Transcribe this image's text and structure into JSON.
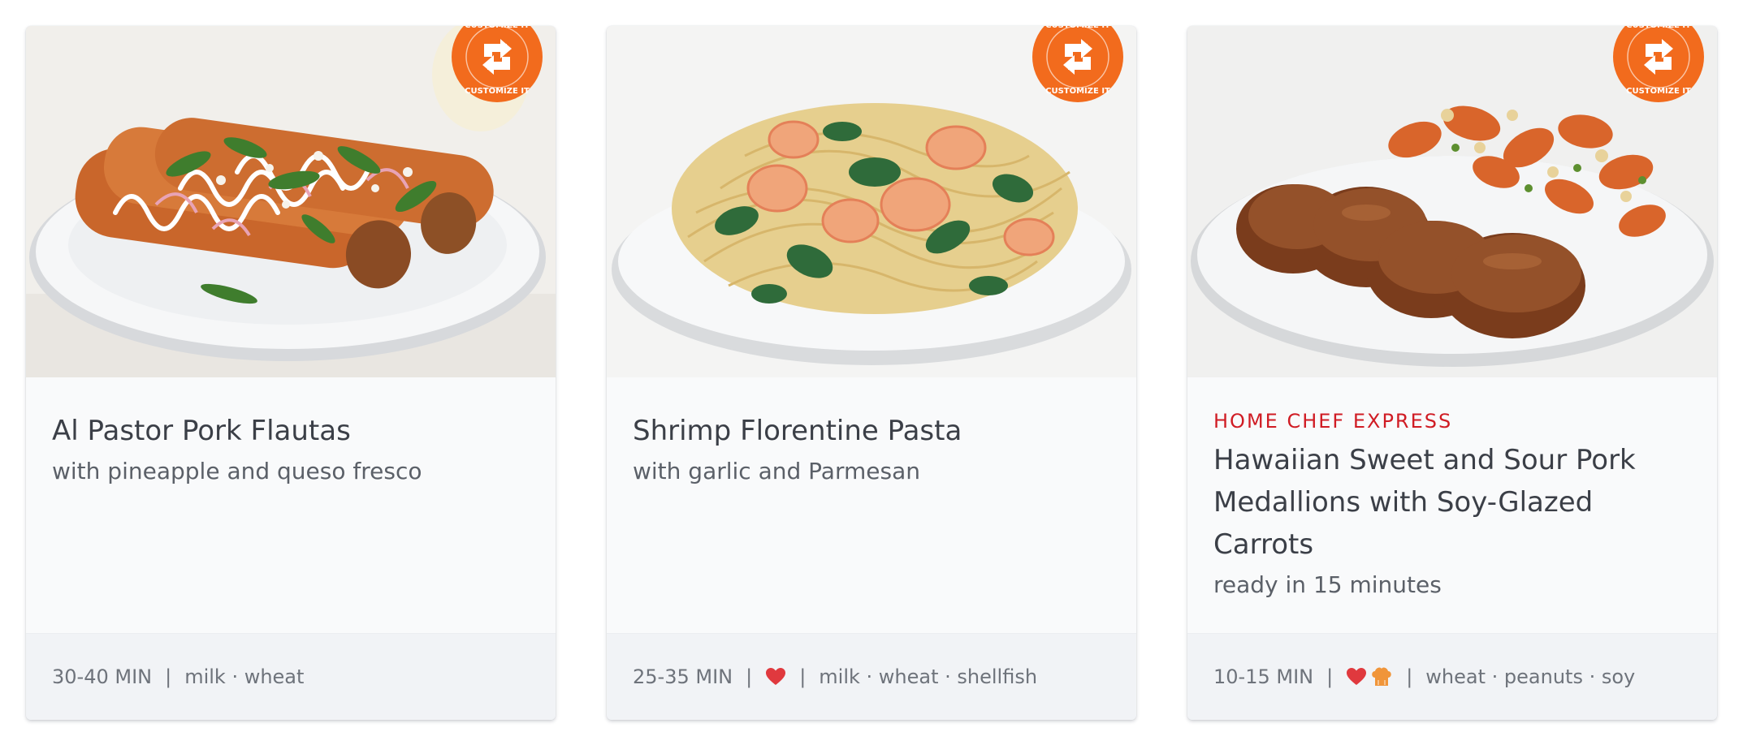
{
  "cards": [
    {
      "badge_text": "CUSTOMIZE IT",
      "eyebrow": "",
      "title": "Al Pastor Pork Flautas",
      "subtitle": "with pineapple and queso fresco",
      "time": "30-40 MIN",
      "separator": "|",
      "icons": [],
      "allergens": "milk · wheat"
    },
    {
      "badge_text": "CUSTOMIZE IT",
      "eyebrow": "",
      "title": "Shrimp Florentine Pasta",
      "subtitle": "with garlic and Parmesan",
      "time": "25-35 MIN",
      "separator": "|",
      "icons": [
        "heart-icon"
      ],
      "allergens": "milk · wheat · shellfish"
    },
    {
      "badge_text": "CUSTOMIZE IT",
      "eyebrow": "HOME CHEF EXPRESS",
      "title": "Hawaiian Sweet and Sour Pork Medallions with Soy-Glazed Carrots",
      "subtitle": "ready in 15 minutes",
      "time": "10-15 MIN",
      "separator": "|",
      "icons": [
        "heart-icon",
        "chef-toque-icon"
      ],
      "allergens": "wheat · peanuts · soy"
    }
  ],
  "colors": {
    "badge": "#f26b1d",
    "eyebrow": "#d01c24",
    "heart": "#e0393e",
    "toque": "#f0953a"
  }
}
